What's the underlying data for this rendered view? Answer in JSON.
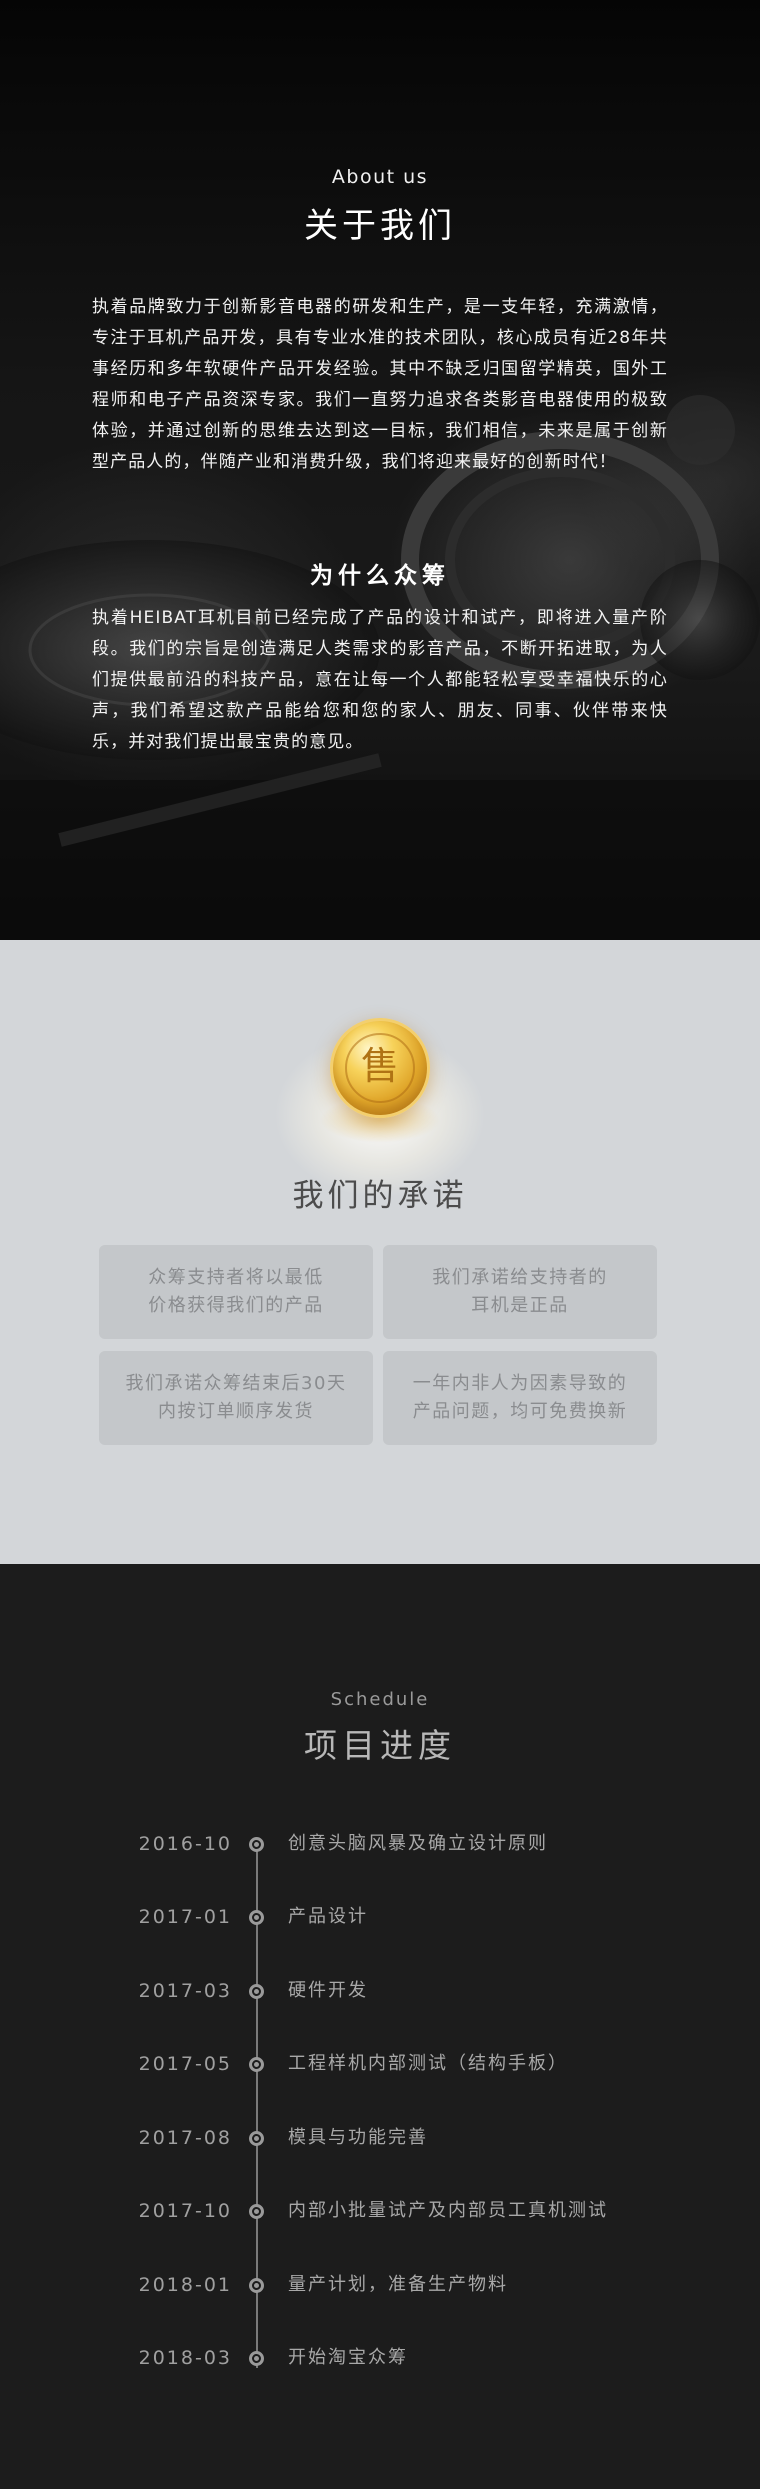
{
  "about": {
    "en_title": "About us",
    "zh_title": "关于我们",
    "paragraph": "执着品牌致力于创新影音电器的研发和生产，是一支年轻，充满激情，专注于耳机产品开发，具有专业水准的技术团队，核心成员有近28年共事经历和多年软硬件产品开发经验。其中不缺乏归国留学精英，国外工程师和电子产品资深专家。我们一直努力追求各类影音电器使用的极致体验，并通过创新的思维去达到这一目标，我们相信，未来是属于创新型产品人的，伴随产业和消费升级，我们将迎来最好的创新时代！",
    "why_title": "为什么众筹",
    "why_paragraph": "执着HEIBAT耳机目前已经完成了产品的设计和试产，即将进入量产阶段。我们的宗旨是创造满足人类需求的影音产品，不断开拓进取，为人们提供最前沿的科技产品，意在让每一个人都能轻松享受幸福快乐的心声，我们希望这款产品能给您和您的家人、朋友、同事、伙伴带来快乐，并对我们提出最宝贵的意见。"
  },
  "promise": {
    "coin_glyph": "售",
    "title": "我们的承诺",
    "cards": [
      {
        "line1": "众筹支持者将以最低",
        "line2": "价格获得我们的产品"
      },
      {
        "line1": "我们承诺给支持者的",
        "line2": "耳机是正品"
      },
      {
        "line1": "我们承诺众筹结束后30天",
        "line2": "内按订单顺序发货"
      },
      {
        "line1": "一年内非人为因素导致的",
        "line2": "产品问题，均可免费换新"
      }
    ]
  },
  "schedule": {
    "en_title": "Schedule",
    "zh_title": "项目进度",
    "items": [
      {
        "date": "2016-10",
        "text": "创意头脑风暴及确立设计原则"
      },
      {
        "date": "2017-01",
        "text": "产品设计"
      },
      {
        "date": "2017-03",
        "text": "硬件开发"
      },
      {
        "date": "2017-05",
        "text": "工程样机内部测试（结构手板）"
      },
      {
        "date": "2017-08",
        "text": "模具与功能完善"
      },
      {
        "date": "2017-10",
        "text": "内部小批量试产及内部员工真机测试"
      },
      {
        "date": "2018-01",
        "text": "量产计划，准备生产物料"
      },
      {
        "date": "2018-03",
        "text": "开始淘宝众筹"
      }
    ]
  }
}
